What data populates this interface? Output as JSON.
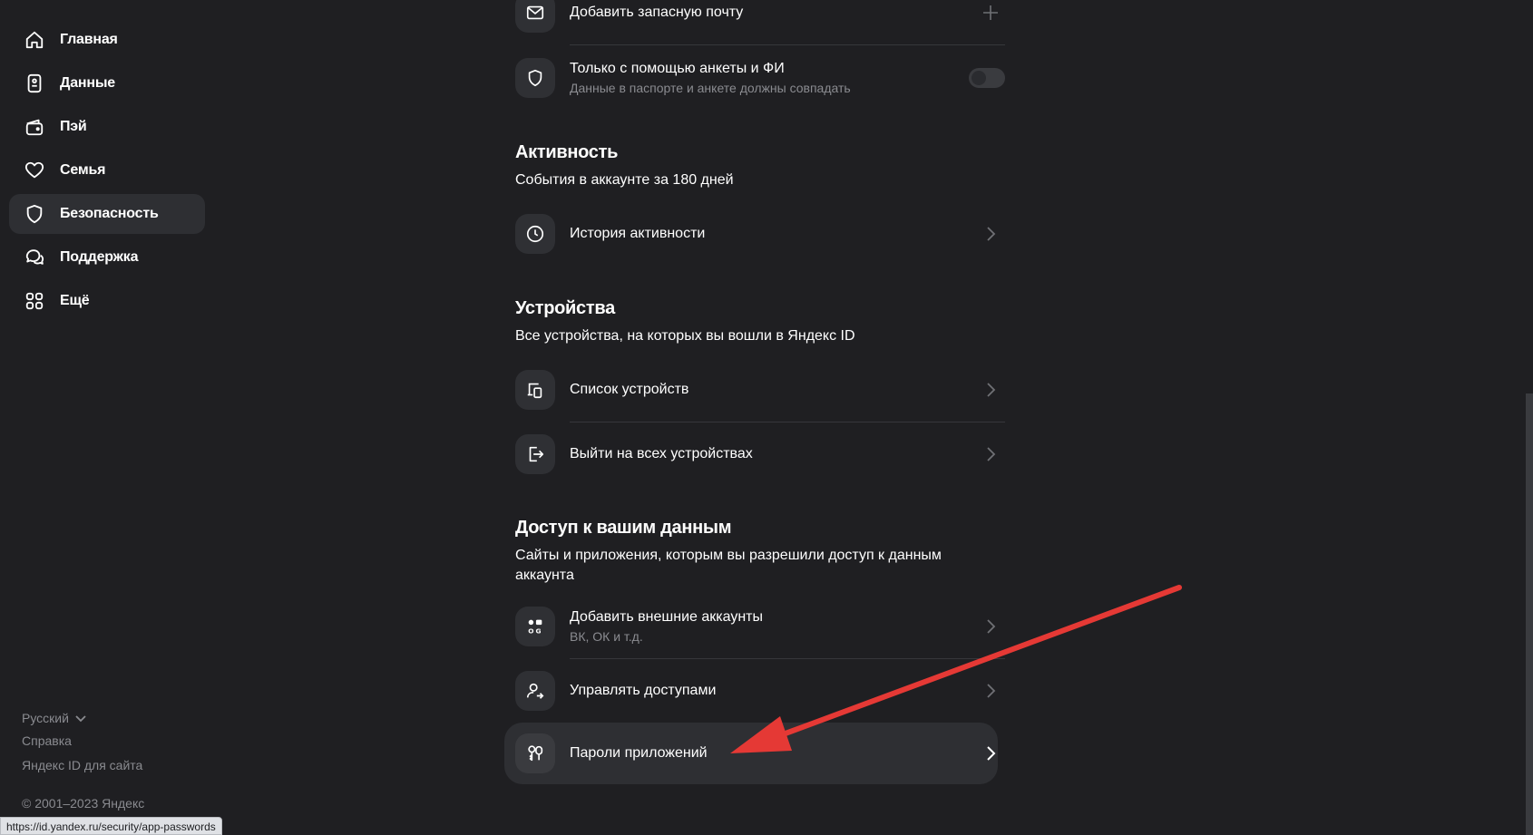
{
  "sidebar": {
    "items": [
      {
        "label": "Главная",
        "icon": "home-icon"
      },
      {
        "label": "Данные",
        "icon": "id-card-icon"
      },
      {
        "label": "Пэй",
        "icon": "wallet-icon"
      },
      {
        "label": "Семья",
        "icon": "heart-icon"
      },
      {
        "label": "Безопасность",
        "icon": "shield-icon",
        "active": true
      },
      {
        "label": "Поддержка",
        "icon": "chat-bubbles-icon"
      },
      {
        "label": "Ещё",
        "icon": "grid-icon"
      }
    ],
    "footer": {
      "language": "Русский",
      "help": "Справка",
      "for_site": "Яндекс ID для сайта",
      "copyright": "© 2001–2023 Яндекс"
    }
  },
  "main": {
    "top_rows": [
      {
        "title": "Добавить запасную почту",
        "icon": "mail-icon",
        "right": "plus-icon"
      },
      {
        "title": "Только с помощью анкеты и ФИ",
        "subtitle": "Данные в паспорте и анкете должны совпадать",
        "icon": "shield-icon",
        "right": "toggle",
        "toggle_on": false
      }
    ],
    "activity": {
      "title": "Активность",
      "subtitle": "События в аккаунте за 180 дней",
      "rows": [
        {
          "title": "История активности",
          "icon": "clock-icon"
        }
      ]
    },
    "devices": {
      "title": "Устройства",
      "subtitle": "Все устройства, на которых вы вошли в Яндекс ID",
      "rows": [
        {
          "title": "Список устройств",
          "icon": "devices-icon"
        },
        {
          "title": "Выйти на всех устройствах",
          "icon": "logout-icon"
        }
      ]
    },
    "access": {
      "title": "Доступ к вашим данным",
      "subtitle": "Сайты и приложения, которым вы разрешили доступ к данным аккаунта",
      "rows": [
        {
          "title": "Добавить внешние аккаунты",
          "subtitle": "ВК, ОК и т.д.",
          "icon": "social-apps-icon"
        },
        {
          "title": "Управлять доступами",
          "icon": "user-share-icon"
        },
        {
          "title": "Пароли приложений",
          "icon": "app-keys-icon",
          "highlighted": true
        }
      ]
    }
  },
  "status_bar": {
    "url": "https://id.yandex.ru/security/app-passwords"
  },
  "colors": {
    "background": "#1f1f22",
    "highlight": "#2e2f33",
    "arrow": "#e53935"
  }
}
